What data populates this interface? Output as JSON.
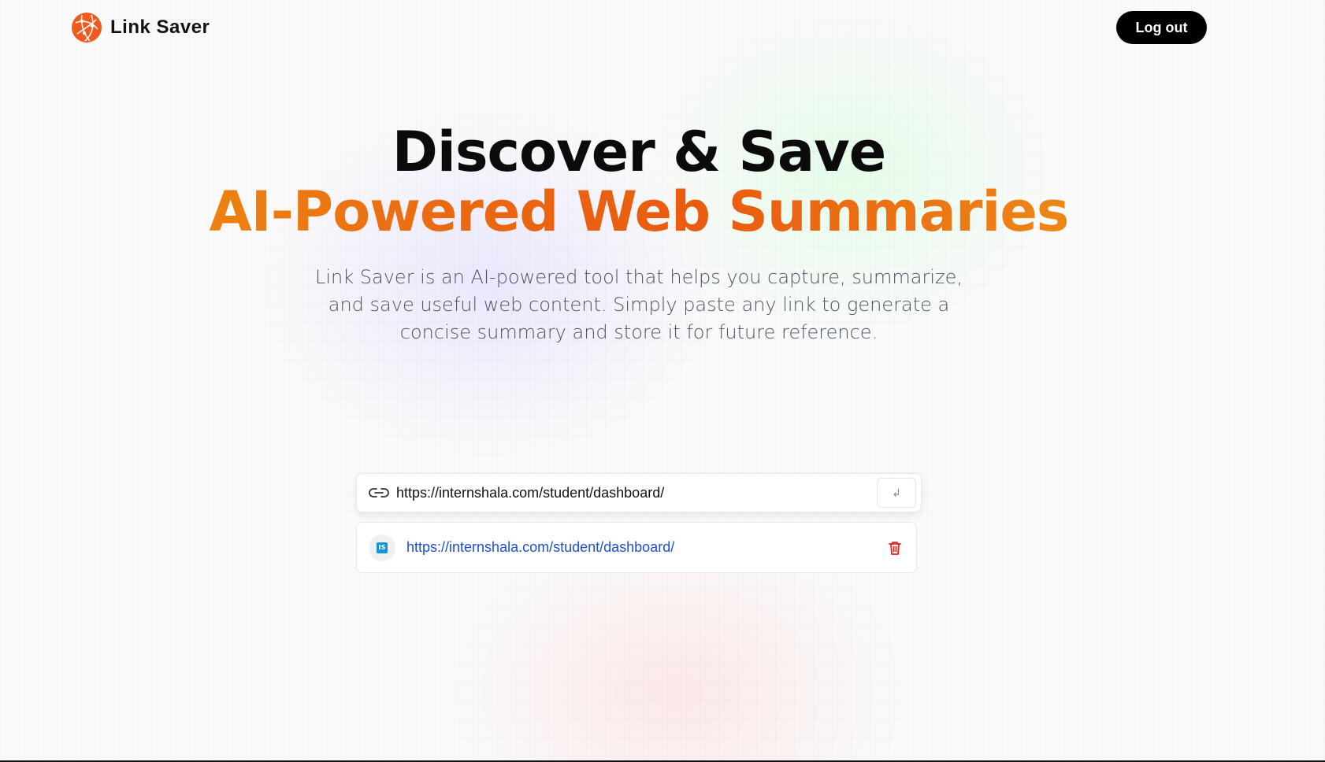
{
  "header": {
    "brand_name": "Link Saver",
    "logo_icon": "globe-icon",
    "logout_label": "Log out"
  },
  "hero": {
    "title_line1": "Discover & Save",
    "title_line2": "AI-Powered Web Summaries",
    "description": "Link Saver is an AI-powered tool that helps you capture, summarize, and save useful web content. Simply paste any link to generate a concise summary and store it for future reference."
  },
  "url_form": {
    "value": "https://internshala.com/student/dashboard/",
    "link_icon": "link-icon",
    "submit_glyph": "↲"
  },
  "saved_links": [
    {
      "url": "https://internshala.com/student/dashboard/",
      "favicon_text": "IS",
      "delete_icon": "trash-icon"
    }
  ],
  "colors": {
    "brand_orange": "#ef5a1f",
    "gradient_start": "#f0950f",
    "gradient_mid": "#ea5a10",
    "gradient_end": "#eda21a",
    "link_blue": "#1d4ed8",
    "delete_red": "#dc2626"
  }
}
